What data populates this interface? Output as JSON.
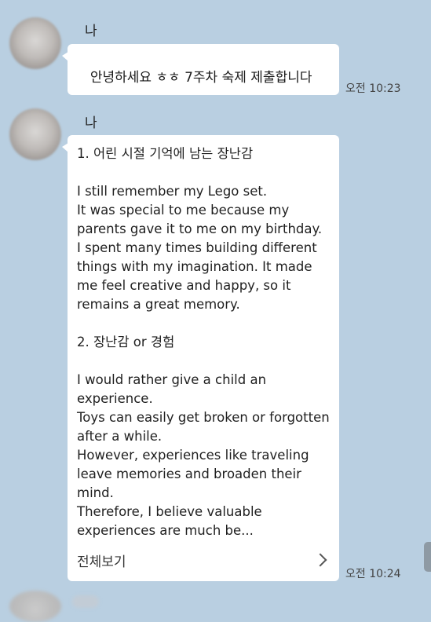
{
  "chat": {
    "messages": [
      {
        "sender": "나",
        "text": "안녕하세요 ㅎㅎ 7주차 숙제 제출합니다",
        "time": "오전 10:23"
      },
      {
        "sender": "나",
        "text": "1. 어린 시절 기억에 남는 장난감\n\nI still remember my Lego set.\nIt was special to me because my parents gave it to me on my birthday.\nI spent many times building different things with my imagination. It made me feel creative and happy, so it remains a great memory.\n\n2. 장난감 or 경험\n\nI would rather give a child an experience.\nToys can easily get broken or forgotten after a while.\nHowever, experiences like traveling leave memories and broaden their mind.\nTherefore, I believe valuable experiences are much be...",
        "more_label": "전체보기",
        "time": "오전 10:24"
      }
    ]
  },
  "icons": {
    "more": "chevron-right-icon",
    "avatar": "blurred-profile-photo"
  },
  "colors": {
    "background": "#b9cfe1",
    "bubble": "#ffffff"
  }
}
